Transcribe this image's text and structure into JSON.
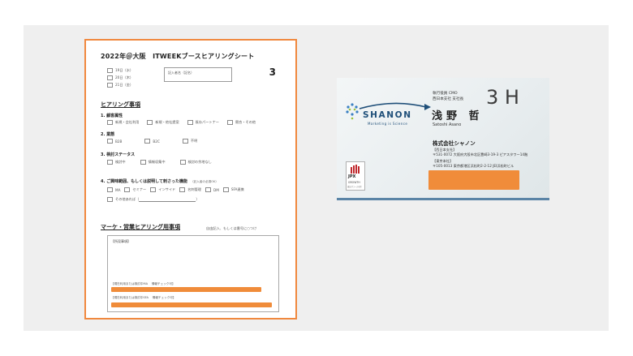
{
  "form": {
    "title": "2022年＠大阪　ITWEEKブースヒアリングシート",
    "sheet_number": "3",
    "dates": [
      "19日（水）",
      "20日（木）",
      "21日（金）"
    ],
    "name_label": "記入者名（記名）",
    "section1_title": "ヒアリング事項",
    "q1": {
      "label": "1. 顧客属性",
      "options": [
        "新規・会社利用",
        "新規・他社提案",
        "既存パートナー",
        "競合・その他"
      ]
    },
    "q2": {
      "label": "2. 業態",
      "options": [
        "B2B",
        "B2C",
        "不明"
      ]
    },
    "q3": {
      "label": "3. 検討ステータス",
      "options": [
        "検討中",
        "情報収集中",
        "検討の余地なし"
      ]
    },
    "q4": {
      "label": "4. ご興味範囲、もしくは説明して刺さった機能",
      "note": "（記入者の必須OK）",
      "options": [
        "MA",
        "セミナー",
        "インサイド",
        "名刺管理",
        "DM",
        "SFA連携"
      ],
      "other": "その他あれば（",
      "other_close": "）"
    },
    "section2_title": "マーケ・営業ヒアリング用事項",
    "section2_note": "自由記入、もしくは番号に○つけ",
    "memo_header": "【所見事項】",
    "line1_label": "【現在利用または検討中MA　 情報チェック可】",
    "line2_label": "【現在利用または検討中SFA　 情報チェック可】"
  },
  "card": {
    "logo": "SHANON",
    "tagline": "Marketing is Science",
    "title1": "執行役員 CMO",
    "title2": "西日本支社 支社長",
    "name": "浅野 哲",
    "name_roman": "Satoshi Asano",
    "handwriting": "3 H",
    "company": "株式会社シャノン",
    "branch1": "【西日本支社】",
    "addr1": "〒531-0072 大阪府大阪市北区豊崎3-19-3 ピアスタワー14階",
    "branch2": "【東京本社】",
    "addr2": "〒105-0013 東京都港区浜松町2-2-12 JEI浜松町ビル",
    "jpx_label": "JPX",
    "jpx_sub": "GROWTH",
    "jpx_tiny": "東証グロース市場"
  },
  "colors": {
    "highlight_border": "#f0883e",
    "redaction": "#f08c3a",
    "brand": "#1f4f79"
  }
}
